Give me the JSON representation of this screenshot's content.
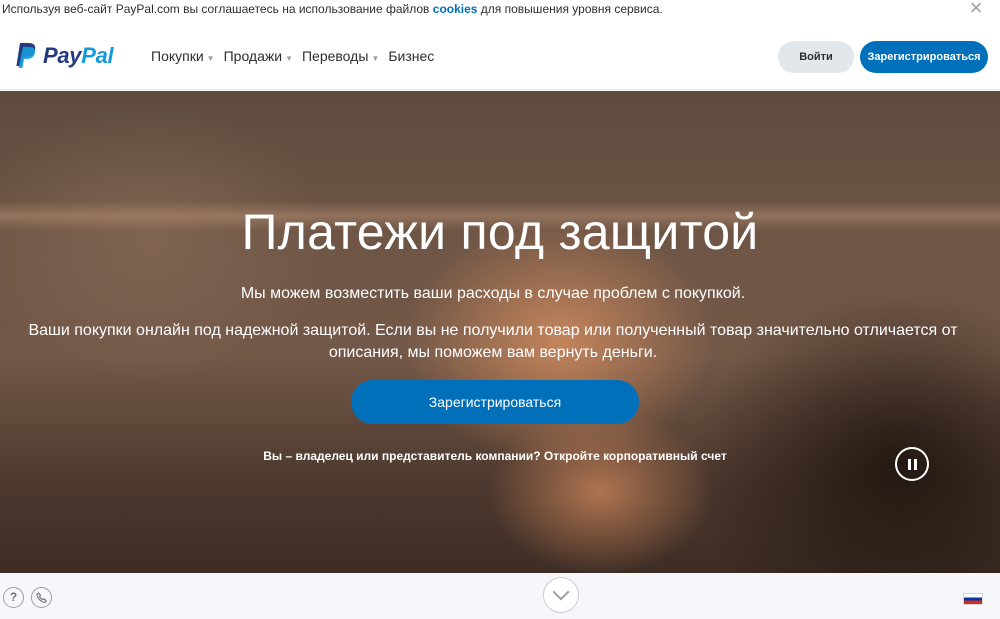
{
  "cookie_bar": {
    "text_before": "Используя веб-сайт PayPal.com вы соглашаетесь на использование файлов ",
    "link": "cookies",
    "text_after": " для повышения уровня сервиса.",
    "close_symbol": "×"
  },
  "header": {
    "logo": {
      "pay": "Pay",
      "pal": "Pal",
      "colors": {
        "pay": "#253b80",
        "pal": "#179bd7"
      }
    },
    "nav": [
      {
        "label": "Покупки",
        "has_dropdown": true
      },
      {
        "label": "Продажи",
        "has_dropdown": true
      },
      {
        "label": "Переводы",
        "has_dropdown": true
      },
      {
        "label": "Бизнес",
        "has_dropdown": false
      }
    ],
    "login_label": "Войти",
    "signup_label": "Зарегистрироваться"
  },
  "hero": {
    "title": "Платежи под защитой",
    "subtitle": "Мы можем возместить ваши расходы в случае проблем с покупкой.",
    "description": "Ваши покупки онлайн под надежной защитой. Если вы не получили товар или полученный товар значительно отличается от описания, мы поможем вам вернуть деньги.",
    "cta_label": "Зарегистрироваться",
    "business_link": "Вы – владелец или представитель компании? Откройте корпоративный счет"
  },
  "footer": {
    "help_symbol": "?",
    "icons": [
      "help-icon",
      "phone-icon",
      "chevron-down-icon",
      "flag-icon"
    ]
  },
  "colors": {
    "accent": "#0070ba",
    "login_bg": "#e1e7eb"
  }
}
